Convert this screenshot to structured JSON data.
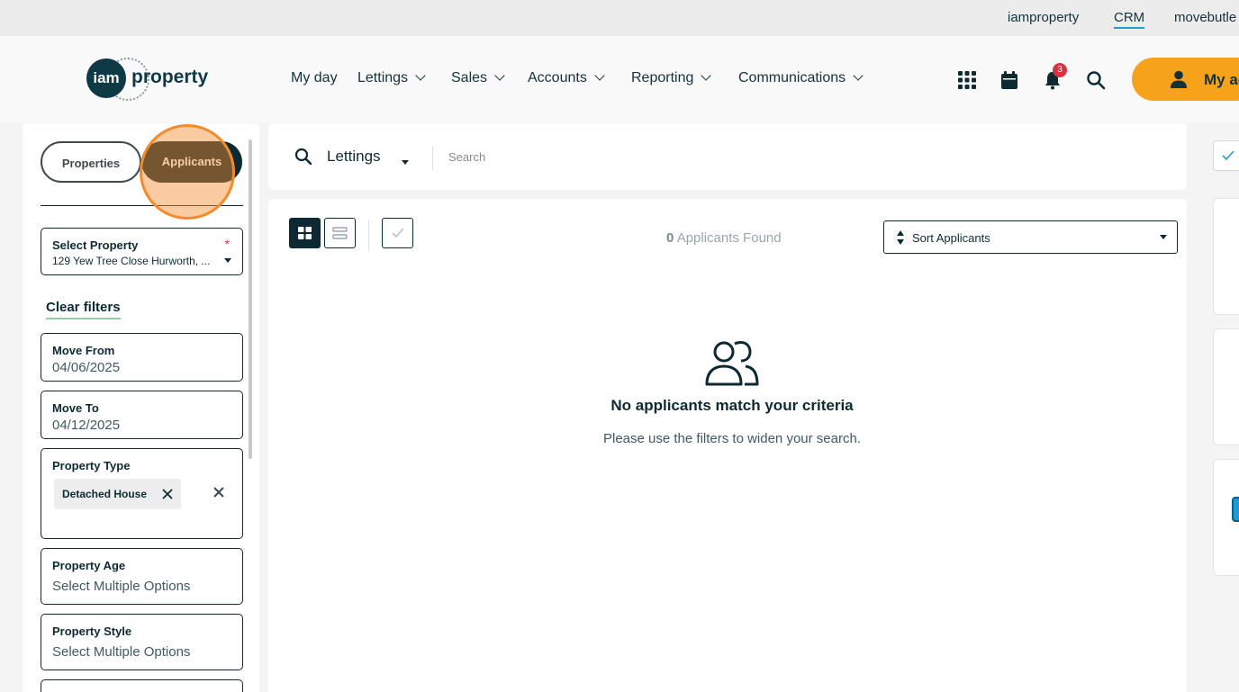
{
  "utility_bar": {
    "links": [
      "iamproperty",
      "CRM",
      "movebutle"
    ]
  },
  "header": {
    "logo_mark": "iam",
    "logo_text": "property",
    "nav": [
      "My day",
      "Lettings",
      "Sales",
      "Accounts",
      "Reporting",
      "Communications"
    ],
    "notification_count": "3",
    "account_label": "My ac"
  },
  "filters": {
    "toggle": {
      "properties": "Properties",
      "applicants": "Applicants"
    },
    "select_property": {
      "label": "Select Property",
      "required": "*",
      "value": "129 Yew Tree Close Hurworth, ..."
    },
    "clear_filters": "Clear filters",
    "move_from": {
      "label": "Move From",
      "value": "04/06/2025"
    },
    "move_to": {
      "label": "Move To",
      "value": "04/12/2025"
    },
    "property_type": {
      "label": "Property Type",
      "chip": "Detached House"
    },
    "property_age": {
      "label": "Property Age",
      "placeholder": "Select Multiple Options"
    },
    "property_style": {
      "label": "Property Style",
      "placeholder": "Select Multiple Options"
    }
  },
  "search": {
    "category": "Lettings",
    "placeholder": "Search"
  },
  "results": {
    "count": "0",
    "count_label": "Applicants Found",
    "sort_label": "Sort Applicants",
    "empty_title": "No applicants match your criteria",
    "empty_subtitle": "Please use the filters to widen your search."
  },
  "colors": {
    "brand_dark": "#0d2a33",
    "accent_orange": "#f6a31b",
    "highlight": "#f28b2c",
    "badge": "#d8323e"
  }
}
